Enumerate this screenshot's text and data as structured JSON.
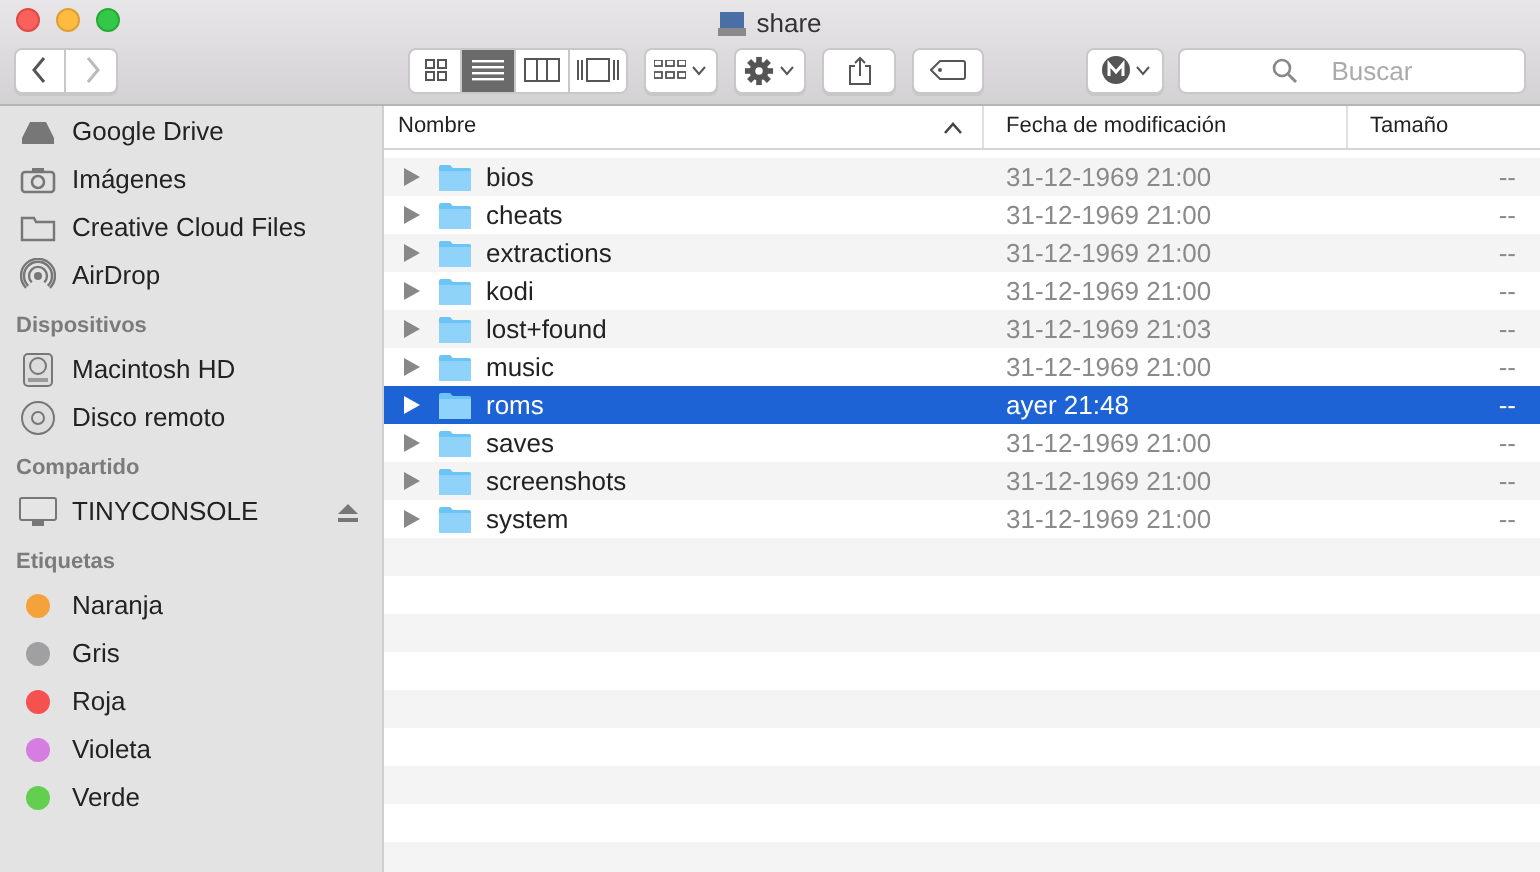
{
  "window": {
    "title": "share"
  },
  "toolbar": {
    "view_modes": [
      {
        "kind": "icons",
        "selected": false
      },
      {
        "kind": "list",
        "selected": true
      },
      {
        "kind": "columns",
        "selected": false
      },
      {
        "kind": "gallery",
        "selected": false
      }
    ],
    "search": {
      "placeholder": "Buscar"
    }
  },
  "sidebar": {
    "sections": [
      {
        "items": [
          {
            "label": "Google Drive",
            "kind": "drive"
          },
          {
            "label": "Imágenes",
            "kind": "camera"
          },
          {
            "label": "Creative Cloud Files",
            "kind": "folder"
          },
          {
            "label": "AirDrop",
            "kind": "airdrop"
          }
        ]
      },
      {
        "title": "Dispositivos",
        "items": [
          {
            "label": "Macintosh HD",
            "kind": "disk"
          },
          {
            "label": "Disco remoto",
            "kind": "disc"
          }
        ]
      },
      {
        "title": "Compartido",
        "items": [
          {
            "label": "TINYCONSOLE",
            "kind": "monitor",
            "eject": true
          }
        ]
      },
      {
        "title": "Etiquetas",
        "items": [
          {
            "label": "Naranja",
            "color": "#f5a23a"
          },
          {
            "label": "Gris",
            "color": "#a0a0a3"
          },
          {
            "label": "Roja",
            "color": "#f6504f"
          },
          {
            "label": "Violeta",
            "color": "#d57de0"
          },
          {
            "label": "Verde",
            "color": "#62cf4f"
          }
        ]
      }
    ]
  },
  "table": {
    "columns": [
      {
        "label": "Nombre",
        "sorted": true
      },
      {
        "label": "Fecha de modificación",
        "sorted": false
      },
      {
        "label": "Tamaño",
        "sorted": false
      }
    ],
    "rows": [
      {
        "name": "bios",
        "date": "31-12-1969 21:00",
        "size": "--",
        "selected": false
      },
      {
        "name": "cheats",
        "date": "31-12-1969 21:00",
        "size": "--",
        "selected": false
      },
      {
        "name": "extractions",
        "date": "31-12-1969 21:00",
        "size": "--",
        "selected": false
      },
      {
        "name": "kodi",
        "date": "31-12-1969 21:00",
        "size": "--",
        "selected": false
      },
      {
        "name": "lost+found",
        "date": "31-12-1969 21:03",
        "size": "--",
        "selected": false
      },
      {
        "name": "music",
        "date": "31-12-1969 21:00",
        "size": "--",
        "selected": false
      },
      {
        "name": "roms",
        "date": "ayer 21:48",
        "size": "--",
        "selected": true
      },
      {
        "name": "saves",
        "date": "31-12-1969 21:00",
        "size": "--",
        "selected": false
      },
      {
        "name": "screenshots",
        "date": "31-12-1969 21:00",
        "size": "--",
        "selected": false
      },
      {
        "name": "system",
        "date": "31-12-1969 21:00",
        "size": "--",
        "selected": false
      }
    ]
  }
}
